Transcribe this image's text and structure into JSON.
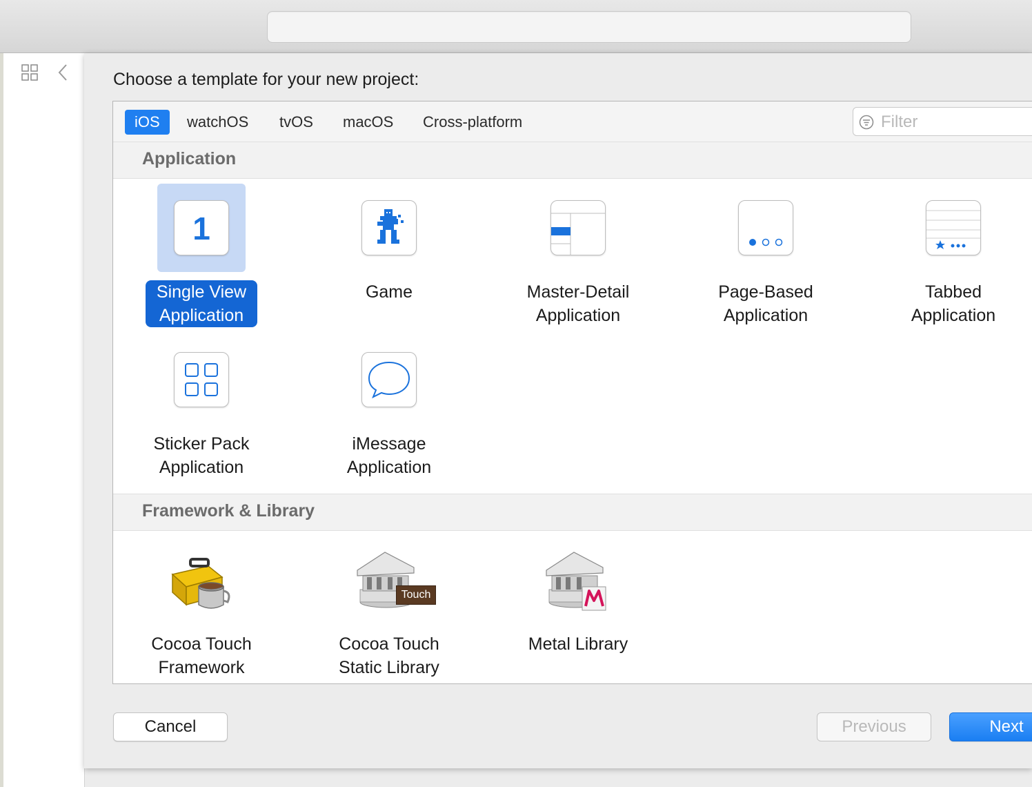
{
  "sheet": {
    "title": "Choose a template for your new project:"
  },
  "tabs": [
    {
      "label": "iOS",
      "selected": true
    },
    {
      "label": "watchOS",
      "selected": false
    },
    {
      "label": "tvOS",
      "selected": false
    },
    {
      "label": "macOS",
      "selected": false
    },
    {
      "label": "Cross-platform",
      "selected": false
    }
  ],
  "filter": {
    "placeholder": "Filter",
    "icon": "filter-icon"
  },
  "sections": [
    {
      "title": "Application",
      "items": [
        {
          "line1": "Single View",
          "line2": "Application",
          "icon": "single-view-icon",
          "selected": true
        },
        {
          "line1": "Game",
          "line2": "",
          "icon": "game-icon",
          "selected": false
        },
        {
          "line1": "Master-Detail",
          "line2": "Application",
          "icon": "master-detail-icon",
          "selected": false
        },
        {
          "line1": "Page-Based",
          "line2": "Application",
          "icon": "page-based-icon",
          "selected": false
        },
        {
          "line1": "Tabbed",
          "line2": "Application",
          "icon": "tabbed-icon",
          "selected": false
        },
        {
          "line1": "Sticker Pack",
          "line2": "Application",
          "icon": "sticker-pack-icon",
          "selected": false
        },
        {
          "line1": "iMessage",
          "line2": "Application",
          "icon": "imessage-icon",
          "selected": false
        }
      ]
    },
    {
      "title": "Framework & Library",
      "items": [
        {
          "line1": "Cocoa Touch",
          "line2": "Framework",
          "icon": "toolbox-icon",
          "selected": false
        },
        {
          "line1": "Cocoa Touch",
          "line2": "Static Library",
          "icon": "static-library-icon",
          "selected": false,
          "badge": "Touch"
        },
        {
          "line1": "Metal Library",
          "line2": "",
          "icon": "metal-library-icon",
          "selected": false
        }
      ]
    }
  ],
  "buttons": {
    "cancel": "Cancel",
    "previous": "Previous",
    "next": "Next"
  },
  "colors": {
    "accent": "#1f7ff0",
    "selection_label": "#1466d4",
    "selection_bg": "#c7d9f5"
  }
}
